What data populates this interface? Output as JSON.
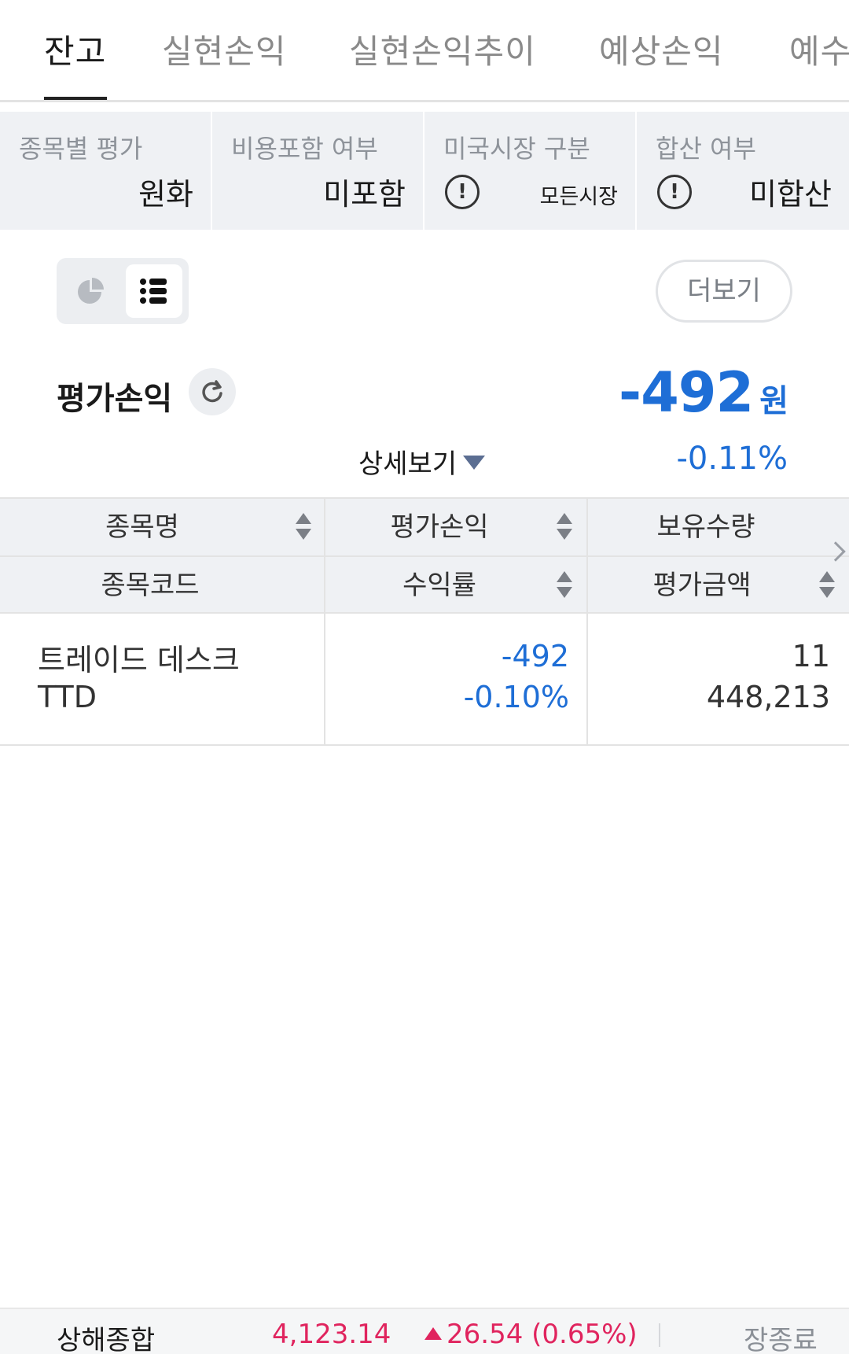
{
  "tabs": [
    {
      "label": "잔고"
    },
    {
      "label": "실현손익"
    },
    {
      "label": "실현손익추이"
    },
    {
      "label": "예상손익"
    },
    {
      "label": "예수"
    }
  ],
  "filters": [
    {
      "label": "종목별 평가",
      "value": "원화"
    },
    {
      "label": "비용포함 여부",
      "value": "미포함"
    },
    {
      "label": "미국시장 구분",
      "value": "모든시장"
    },
    {
      "label": "합산 여부",
      "value": "미합산"
    }
  ],
  "more_button": "더보기",
  "summary": {
    "label": "평가손익",
    "value": "-492",
    "unit": "원",
    "detail_link": "상세보기",
    "rate": "-0.11%"
  },
  "table": {
    "headers_row1": [
      "종목명",
      "평가손익",
      "보유수량"
    ],
    "headers_row2": [
      "종목코드",
      "수익률",
      "평가금액"
    ],
    "rows": [
      {
        "name": "트레이드 데스크",
        "code": "TTD",
        "pnl": "-492",
        "rate": "-0.10%",
        "quantity": "11",
        "value": "448,213"
      }
    ]
  },
  "ticker": {
    "name": "상해종합",
    "price": "4,123.14",
    "change": "26.54 (0.65%)",
    "status": "장종료"
  },
  "colors": {
    "accent_blue": "#1e6ed6",
    "up_red": "#e0245e",
    "panel_gray": "#eff1f4"
  }
}
